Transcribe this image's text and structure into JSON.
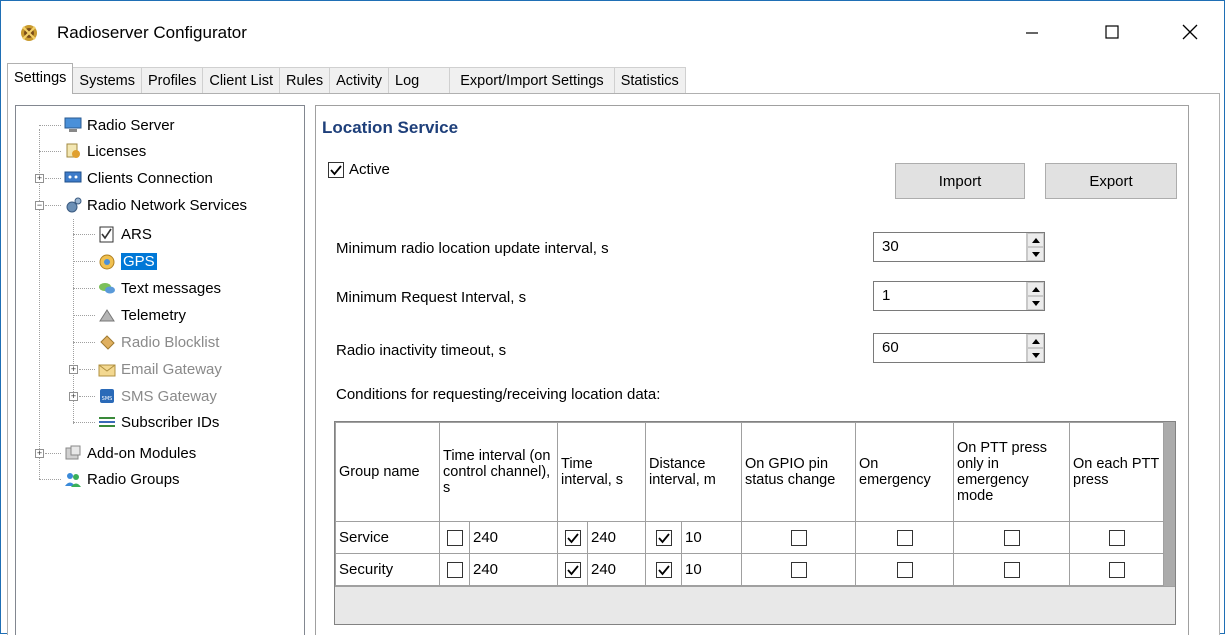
{
  "window": {
    "title": "Radioserver Configurator"
  },
  "tabs": [
    {
      "label": "Settings",
      "active": true
    },
    {
      "label": "Systems"
    },
    {
      "label": "Profiles"
    },
    {
      "label": "Client List"
    },
    {
      "label": "Rules"
    },
    {
      "label": "Activity"
    },
    {
      "label": "Log"
    },
    {
      "label": "Export/Import Settings"
    },
    {
      "label": "Statistics"
    }
  ],
  "tree": {
    "items": [
      {
        "label": "Radio Server"
      },
      {
        "label": "Licenses"
      },
      {
        "label": "Clients Connection"
      },
      {
        "label": "Radio Network Services"
      },
      {
        "label": "ARS"
      },
      {
        "label": "GPS",
        "selected": true
      },
      {
        "label": "Text messages"
      },
      {
        "label": "Telemetry"
      },
      {
        "label": "Radio Blocklist",
        "disabled": true
      },
      {
        "label": "Email Gateway",
        "disabled": true
      },
      {
        "label": "SMS Gateway",
        "disabled": true
      },
      {
        "label": "Subscriber IDs"
      },
      {
        "label": "Add-on Modules"
      },
      {
        "label": "Radio Groups"
      }
    ]
  },
  "location_service": {
    "title": "Location Service",
    "active_label": "Active",
    "active_checked": true,
    "import_label": "Import",
    "export_label": "Export",
    "fields": [
      {
        "label": "Minimum radio location update interval, s",
        "value": "30"
      },
      {
        "label": "Minimum Request Interval, s",
        "value": "1"
      },
      {
        "label": "Radio inactivity timeout, s",
        "value": "60"
      }
    ],
    "conditions_label": "Conditions for requesting/receiving location data:",
    "grid": {
      "headers": [
        "Group name",
        "Time interval (on control channel), s",
        "Time interval, s",
        "Distance interval, m",
        "On GPIO pin status change",
        "On emergency",
        "On PTT press only in emergency mode",
        "On each PTT press"
      ],
      "rows": [
        {
          "group": "Service",
          "cc_checked": false,
          "cc_value": "240",
          "ti_checked": true,
          "ti_value": "240",
          "di_checked": true,
          "di_value": "10",
          "gpio": false,
          "emergency": false,
          "ptt_emergency": false,
          "ptt_each": false
        },
        {
          "group": "Security",
          "cc_checked": false,
          "cc_value": "240",
          "ti_checked": true,
          "ti_value": "240",
          "di_checked": true,
          "di_value": "10",
          "gpio": false,
          "emergency": false,
          "ptt_emergency": false,
          "ptt_each": false
        }
      ]
    }
  },
  "icons": {
    "app": "radio-tower-app-icon",
    "minimize": "minimize-icon",
    "maximize": "maximize-icon",
    "close": "close-icon"
  },
  "colors": {
    "selection": "#0078d7",
    "section_title": "#1e3f7a",
    "window_border": "#1f6fb5"
  }
}
